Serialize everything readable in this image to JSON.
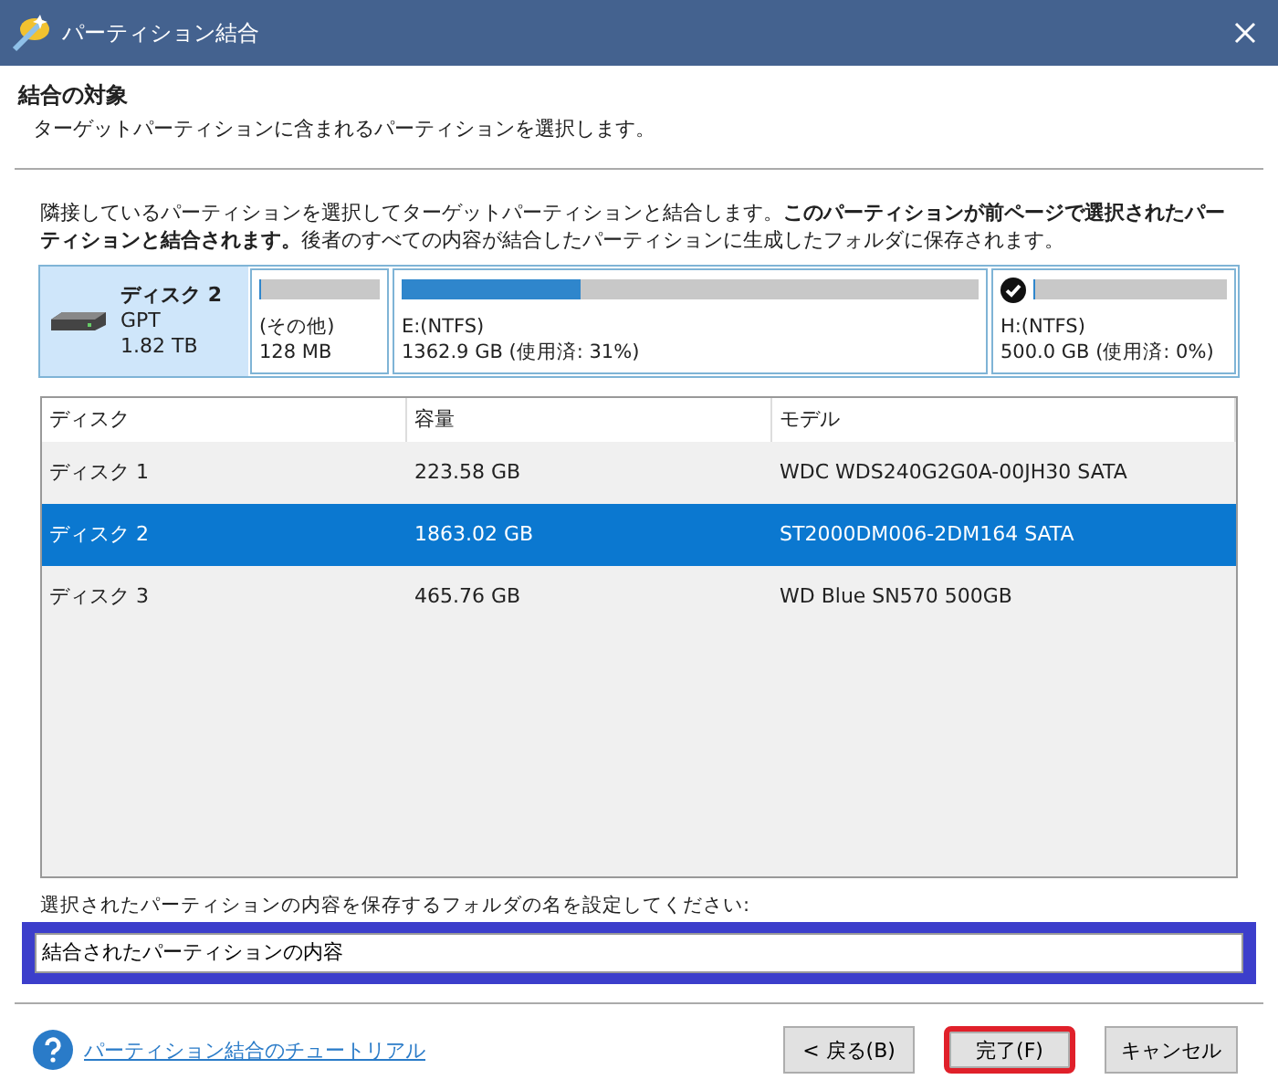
{
  "window": {
    "title": "パーティション結合"
  },
  "header": {
    "title": "結合の対象",
    "subtitle": "ターゲットパーティションに含まれるパーティションを選択します。"
  },
  "description": "隣接しているパーティションを選択してターゲットパーティションと結合します。**このパーティションが前ページで選択されたパーティションと結合されます。**後者のすべての内容が結合したパーティションに生成したフォルダに保存されます。",
  "disk_map": {
    "disk": {
      "name": "ディスク 2",
      "style": "GPT",
      "size": "1.82 TB",
      "selected": true
    },
    "partitions": [
      {
        "label": "(その他)",
        "size": "128 MB",
        "level": 0,
        "checked": false
      },
      {
        "label": "E:(NTFS)",
        "size": "1362.9 GB (使用済: 31%)",
        "level": 0.31,
        "checked": false
      },
      {
        "label": "H:(NTFS)",
        "size": "500.0 GB (使用済: 0%)",
        "level": 0,
        "checked": true
      }
    ]
  },
  "table": {
    "columns": [
      "ディスク",
      "容量",
      "モデル"
    ],
    "rows": [
      {
        "cells": [
          "ディスク 1",
          "223.58 GB",
          "WDC WDS240G2G0A-00JH30 SATA"
        ],
        "selected": false
      },
      {
        "cells": [
          "ディスク 2",
          "1863.02 GB",
          "ST2000DM006-2DM164 SATA"
        ],
        "selected": true
      },
      {
        "cells": [
          "ディスク 3",
          "465.76 GB",
          "WD Blue SN570 500GB"
        ],
        "selected": false
      }
    ]
  },
  "folder": {
    "label": "選択されたパーティションの内容を保存するフォルダの名を設定してください:",
    "value": "結合されたパーティションの内容",
    "highlighted": true
  },
  "tutorial_link": "パーティション結合のチュートリアル",
  "buttons": [
    {
      "label": "< 戻る(B)",
      "highlighted": false
    },
    {
      "label": "完了(F)",
      "highlighted": true
    },
    {
      "label": "キャンセル",
      "highlighted": false
    }
  ]
}
